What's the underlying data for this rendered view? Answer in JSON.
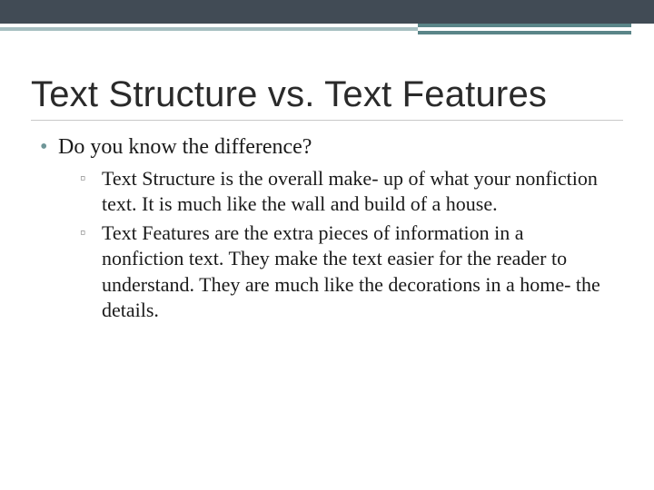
{
  "colors": {
    "topbar": "#414b55",
    "accent_light": "#a6bfc1",
    "accent_dark": "#5a8588",
    "bullet1": "#6f9698",
    "bullet2": "#8a8a8a"
  },
  "title": "Text Structure vs. Text Features",
  "bullets": [
    {
      "text": "Do you know the difference?",
      "subbullets": [
        "Text Structure is the overall make- up of what your nonfiction text.  It is much like the wall and build of a house.",
        "Text Features are the extra pieces of information in a nonfiction text.  They make the text easier for the reader to understand.  They are much like the decorations in a home- the details."
      ]
    }
  ]
}
